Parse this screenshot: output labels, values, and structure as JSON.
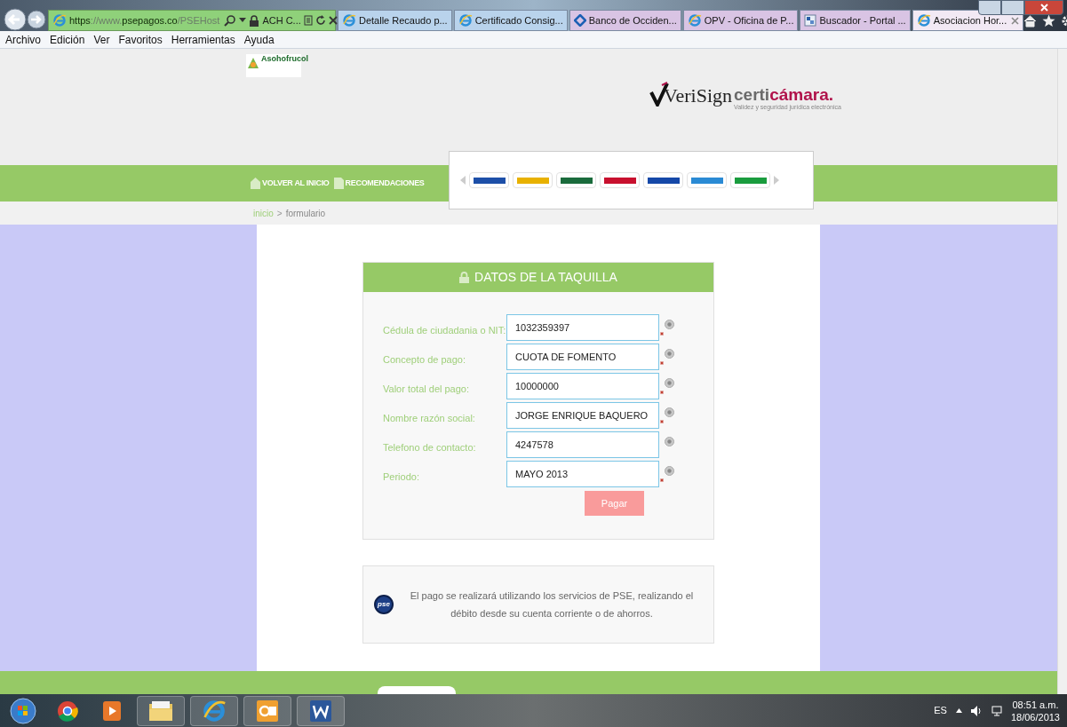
{
  "browser": {
    "address_segments": [
      {
        "text": "https",
        "strong": true
      },
      {
        "text": "://www.",
        "strong": false
      },
      {
        "text": "psepagos.co",
        "strong": true
      },
      {
        "text": "/PSEHost",
        "strong": false
      }
    ],
    "site_identity": "ACH C...",
    "tabs": [
      {
        "label": "Detalle Recaudo p...",
        "selected": false,
        "closable": false
      },
      {
        "label": "Certificado Consig...",
        "selected": false,
        "closable": false
      },
      {
        "label": "Banco de Occiden...",
        "selected": false,
        "closable": false
      },
      {
        "label": "OPV - Oficina de P...",
        "selected": false,
        "closable": false
      },
      {
        "label": "Buscador - Portal ...",
        "selected": false,
        "closable": false
      },
      {
        "label": "Asociacion Hor...",
        "selected": true,
        "closable": true
      }
    ],
    "menu": [
      "Archivo",
      "Edición",
      "Ver",
      "Favoritos",
      "Herramientas",
      "Ayuda"
    ]
  },
  "header": {
    "logo_text": "Asohofrucol",
    "verisign": "VeriSign",
    "certicamara_a": "certi",
    "certicamara_b": "cámara.",
    "certicamara_tagline": "Validez y seguridad jurídica electrónica"
  },
  "nav": [
    "VOLVER AL INICIO",
    "RECOMENDACIONES"
  ],
  "breadcrumb": {
    "link": "inicio",
    "separator": ">",
    "current": "formulario"
  },
  "form": {
    "title": "DATOS DE LA TAQUILLA",
    "fields": [
      {
        "label": "Cédula de ciudadania o NIT:",
        "value": "1032359397",
        "required": true
      },
      {
        "label": "Concepto de pago:",
        "value": "CUOTA DE FOMENTO",
        "required": true
      },
      {
        "label": "Valor total del pago:",
        "value": "10000000",
        "required": true
      },
      {
        "label": "Nombre razón social:",
        "value": "JORGE ENRIQUE BAQUERO",
        "required": true
      },
      {
        "label": "Telefono de contacto:",
        "value": "4247578",
        "required": false
      },
      {
        "label": "Periodo:",
        "value": "MAYO 2013",
        "required": true
      }
    ],
    "submit": "Pagar"
  },
  "notice": {
    "logo": "pse",
    "text": "El pago se realizará utilizando los servicios de PSE, realizando el débito desde su cuenta corriente o de ahorros."
  },
  "taskbar": {
    "language": "ES",
    "time": "08:51 a.m.",
    "date": "18/06/2013"
  }
}
